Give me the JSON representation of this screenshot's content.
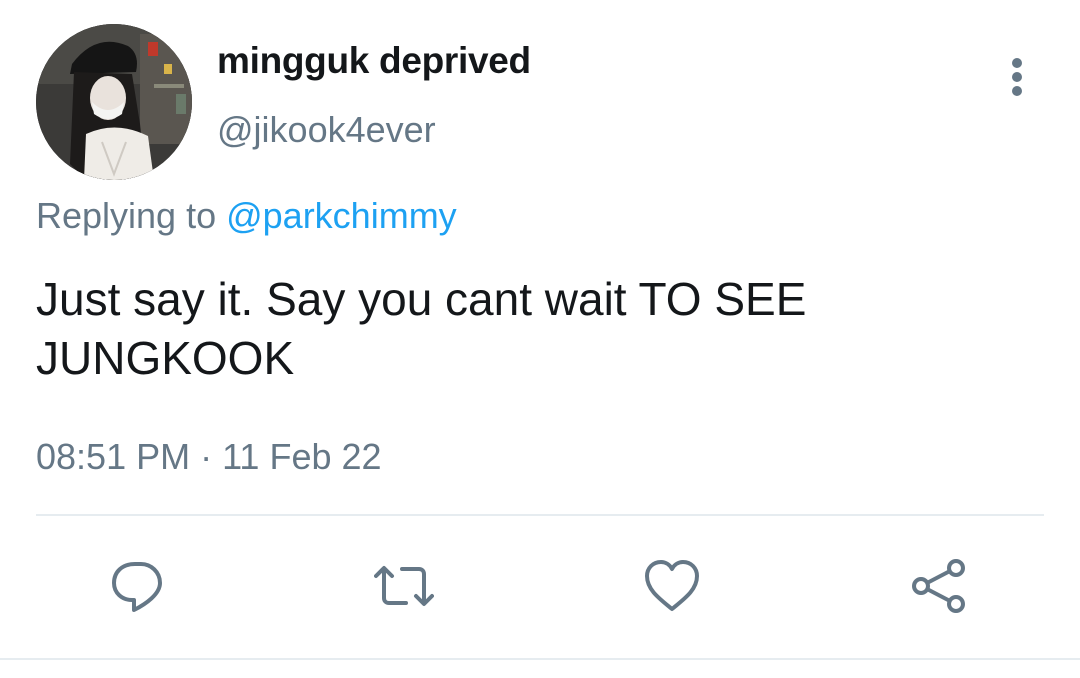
{
  "tweet": {
    "author": {
      "display_name": "mingguk deprived",
      "handle": "@jikook4ever"
    },
    "reply": {
      "prefix": "Replying to ",
      "to_handle": "@parkchimmy"
    },
    "text_line1": "Just say it. Say you cant wait TO SEE",
    "text_line2": "JUNGKOOK",
    "timestamp": "08:51 PM · 11 Feb 22"
  },
  "actions": [
    {
      "name": "reply",
      "icon": "comment-icon"
    },
    {
      "name": "retweet",
      "icon": "retweet-icon"
    },
    {
      "name": "like",
      "icon": "heart-icon"
    },
    {
      "name": "share",
      "icon": "share-icon"
    }
  ],
  "colors": {
    "text_primary": "#14171a",
    "text_secondary": "#657786",
    "link": "#1da1f2",
    "divider": "#e6ecf0"
  }
}
